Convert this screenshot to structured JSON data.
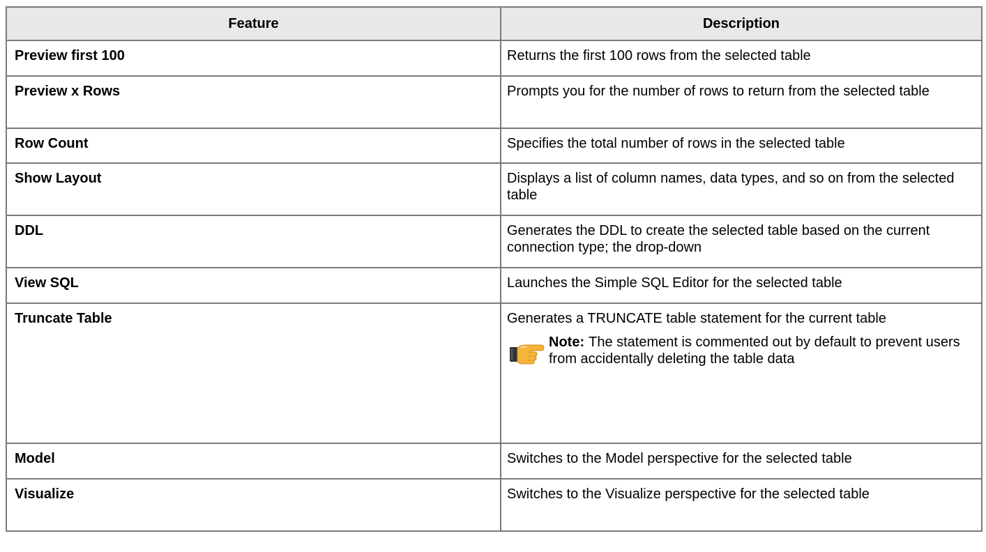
{
  "table": {
    "headers": {
      "feature": "Feature",
      "description": "Description"
    },
    "rows": [
      {
        "feature": "Preview first 100",
        "description": "Returns the first 100 rows from the selected table"
      },
      {
        "feature": "Preview x Rows",
        "description": "Prompts you for the number of rows to return from the selected table"
      },
      {
        "feature": "Row Count",
        "description": "Specifies the total number of rows in the selected table"
      },
      {
        "feature": "Show Layout",
        "description": "Displays a list of column names, data types, and so on from the selected table"
      },
      {
        "feature": "DDL",
        "description": "Generates the DDL to create the selected table based on the current connection type; the drop-down"
      },
      {
        "feature": "View SQL",
        "description": "Launches the Simple SQL Editor for the selected table"
      },
      {
        "feature": "Truncate Table",
        "description": "Generates a TRUNCATE table statement for the current table",
        "note_label": "Note:",
        "note_text": "The statement is commented out by default to prevent users from accidentally deleting the table data"
      },
      {
        "feature": "Model",
        "description": "Switches to the Model perspective for the selected table"
      },
      {
        "feature": "Visualize",
        "description": "Switches to the Visualize perspective for the selected table"
      }
    ]
  },
  "icons": {
    "note_icon": "pointing-hand-icon",
    "note_icon_colors": {
      "hand": "#f5b43a",
      "hand_shadow": "#d4891c",
      "cuff": "#333333"
    }
  }
}
